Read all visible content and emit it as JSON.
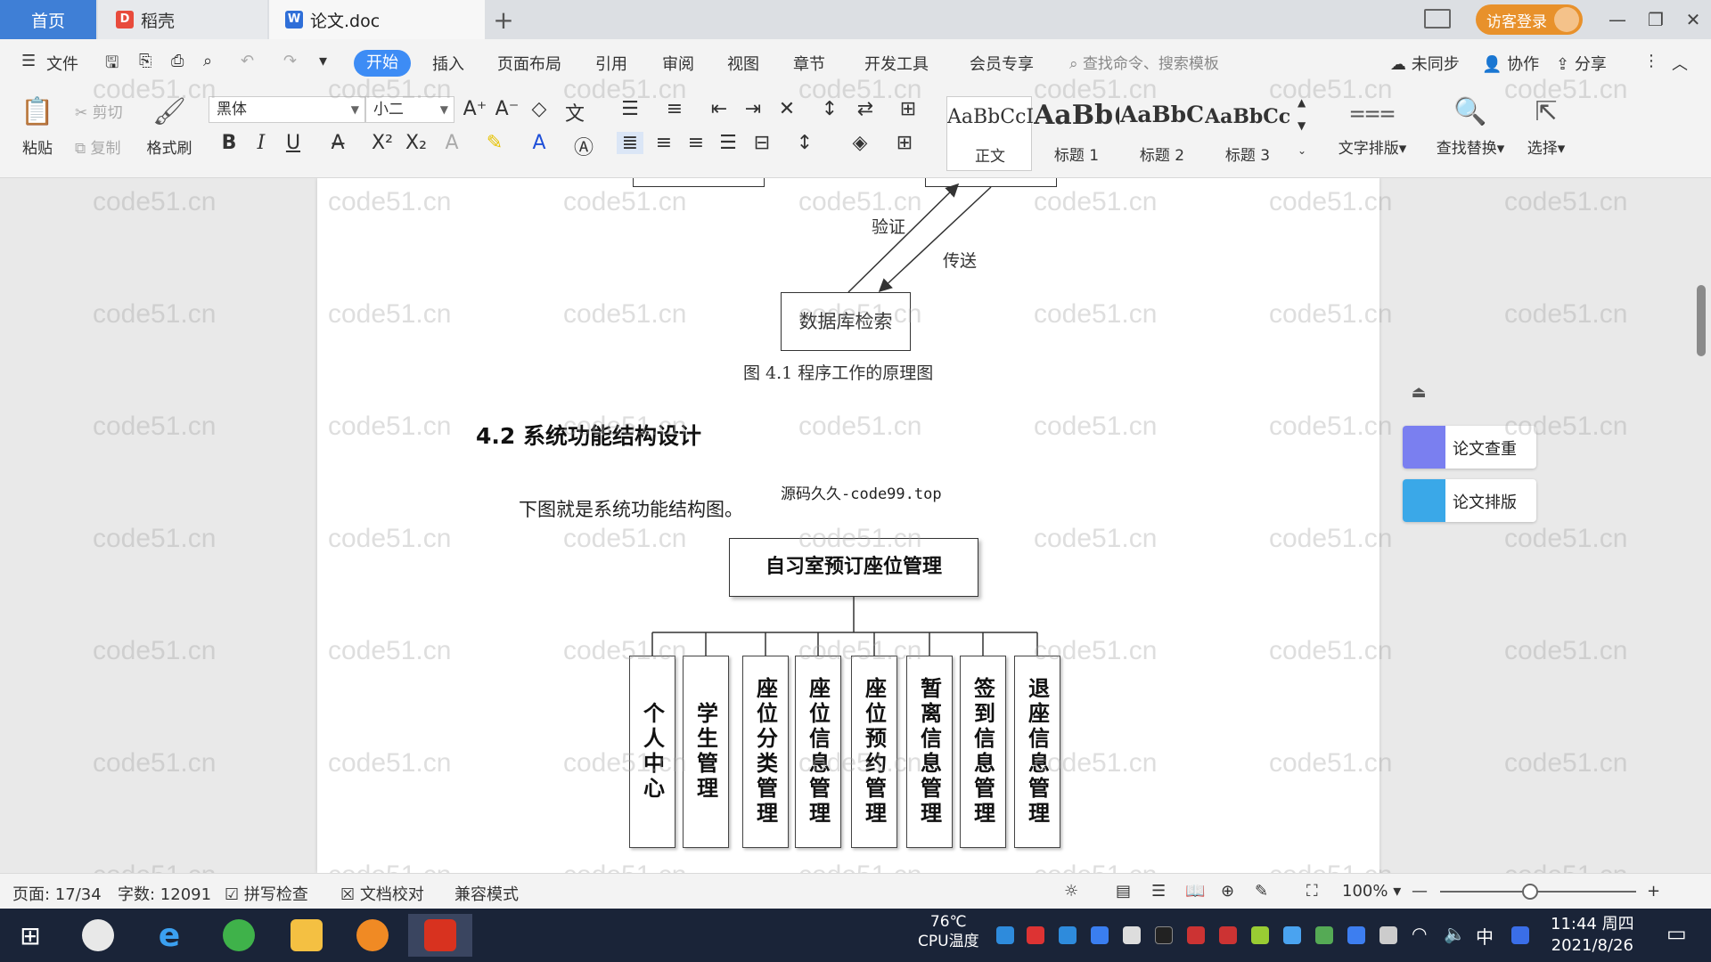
{
  "tabs": {
    "home": "首页",
    "daoke": "稻壳",
    "doc": "论文.doc",
    "add": "+"
  },
  "titlebar": {
    "guest_login": "访客登录"
  },
  "menu": {
    "file": "文件",
    "start": "开始",
    "insert": "插入",
    "page_layout": "页面布局",
    "reference": "引用",
    "review": "审阅",
    "view": "视图",
    "chapter": "章节",
    "dev_tools": "开发工具",
    "member": "会员专享",
    "search_placeholder": "查找命令、搜索模板",
    "not_synced": "未同步",
    "collaborate": "协作",
    "share": "分享"
  },
  "ribbon": {
    "paste": "粘贴",
    "cut": "剪切",
    "copy": "复制",
    "format_painter": "格式刷",
    "font_name": "黑体",
    "font_size": "小二",
    "styles": [
      {
        "sample": "AaBbCcI",
        "name": "正文"
      },
      {
        "sample": "AaBb(",
        "name": "标题 1"
      },
      {
        "sample": "AaBbC",
        "name": "标题 2"
      },
      {
        "sample": "AaBbCcl",
        "name": "标题 3"
      }
    ],
    "text_layout": "文字排版",
    "find_replace": "查找替换",
    "select": "选择"
  },
  "document": {
    "label_verify": "验证",
    "label_send": "传送",
    "db_search": "数据库检索",
    "figure_caption": "图 4.1  程序工作的原理图",
    "section_heading": "4.2 系统功能结构设计",
    "source_note": "源码久久-code99.top",
    "body_text": "下图就是系统功能结构图。",
    "root_node": "自习室预订座位管理",
    "modules": [
      "个人中心",
      "学生管理",
      "座位分类管理",
      "座位信息管理",
      "座位预约管理",
      "暂离信息管理",
      "签到信息管理",
      "退座信息管理"
    ],
    "watermark": "code51.cn"
  },
  "side_panel": {
    "plagiarism_check": "论文查重",
    "paper_layout": "论文排版"
  },
  "status": {
    "page": "页面: 17/34",
    "words": "字数: 12091",
    "spell_check": "拼写检查",
    "doc_proof": "文档校对",
    "compat_mode": "兼容模式",
    "zoom": "100%"
  },
  "taskbar": {
    "cpu_temp": "76℃",
    "cpu_label": "CPU温度",
    "ime": "中",
    "time": "11:44 周四",
    "date": "2021/8/26"
  },
  "colors": {
    "accent_blue": "#3d8cf5",
    "guest_orange": "#e8912b",
    "taskbar": "#1a2438"
  }
}
